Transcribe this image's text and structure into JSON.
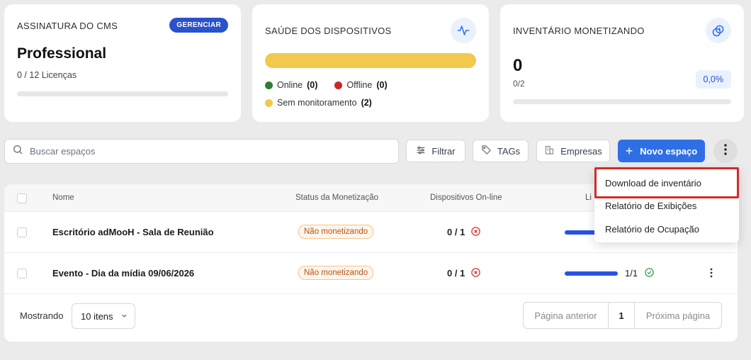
{
  "cards": {
    "cms": {
      "title": "ASSINATURA DO CMS",
      "manage_label": "GERENCIAR",
      "plan": "Professional",
      "licenses": "0 / 12 Licenças"
    },
    "health": {
      "title": "SAÚDE DOS DISPOSITIVOS",
      "icon": "activity-icon",
      "online_label": "Online",
      "online_count": "(0)",
      "offline_label": "Offline",
      "offline_count": "(0)",
      "unmonitored_label": "Sem monitoramento",
      "unmonitored_count": "(2)"
    },
    "inventory": {
      "title": "INVENTÁRIO MONETIZANDO",
      "icon": "money-icon",
      "value": "0",
      "sub": "0/2",
      "percent": "0,0%"
    }
  },
  "toolbar": {
    "search_placeholder": "Buscar espaços",
    "filter_label": "Filtrar",
    "tags_label": "TAGs",
    "companies_label": "Empresas",
    "new_space_label": "Novo espaço"
  },
  "table": {
    "headers": {
      "name": "Nome",
      "monetization": "Status da Monetização",
      "devices": "Dispositivos On-line",
      "licenses": "Li"
    },
    "rows": [
      {
        "name": "Escritório adMooH - Sala de Reunião",
        "status": "Não monetizando",
        "devices": "0 / 1"
      },
      {
        "name": "Evento - Dia da mídia 09/06/2026",
        "status": "Não monetizando",
        "devices": "0 / 1",
        "licenses": "1/1"
      }
    ]
  },
  "footer": {
    "showing_label": "Mostrando",
    "per_page": "10 itens",
    "prev_label": "Página anterior",
    "page": "1",
    "next_label": "Próxima página"
  },
  "menu": {
    "items": [
      "Download de inventário",
      "Relatório de Exibições",
      "Relatório de Ocupação"
    ]
  },
  "colors": {
    "accent": "#2f6fe6",
    "online": "#2e7d32",
    "offline": "#c62828",
    "unmonitored": "#f2c94c",
    "highlight": "#d42a2a"
  }
}
